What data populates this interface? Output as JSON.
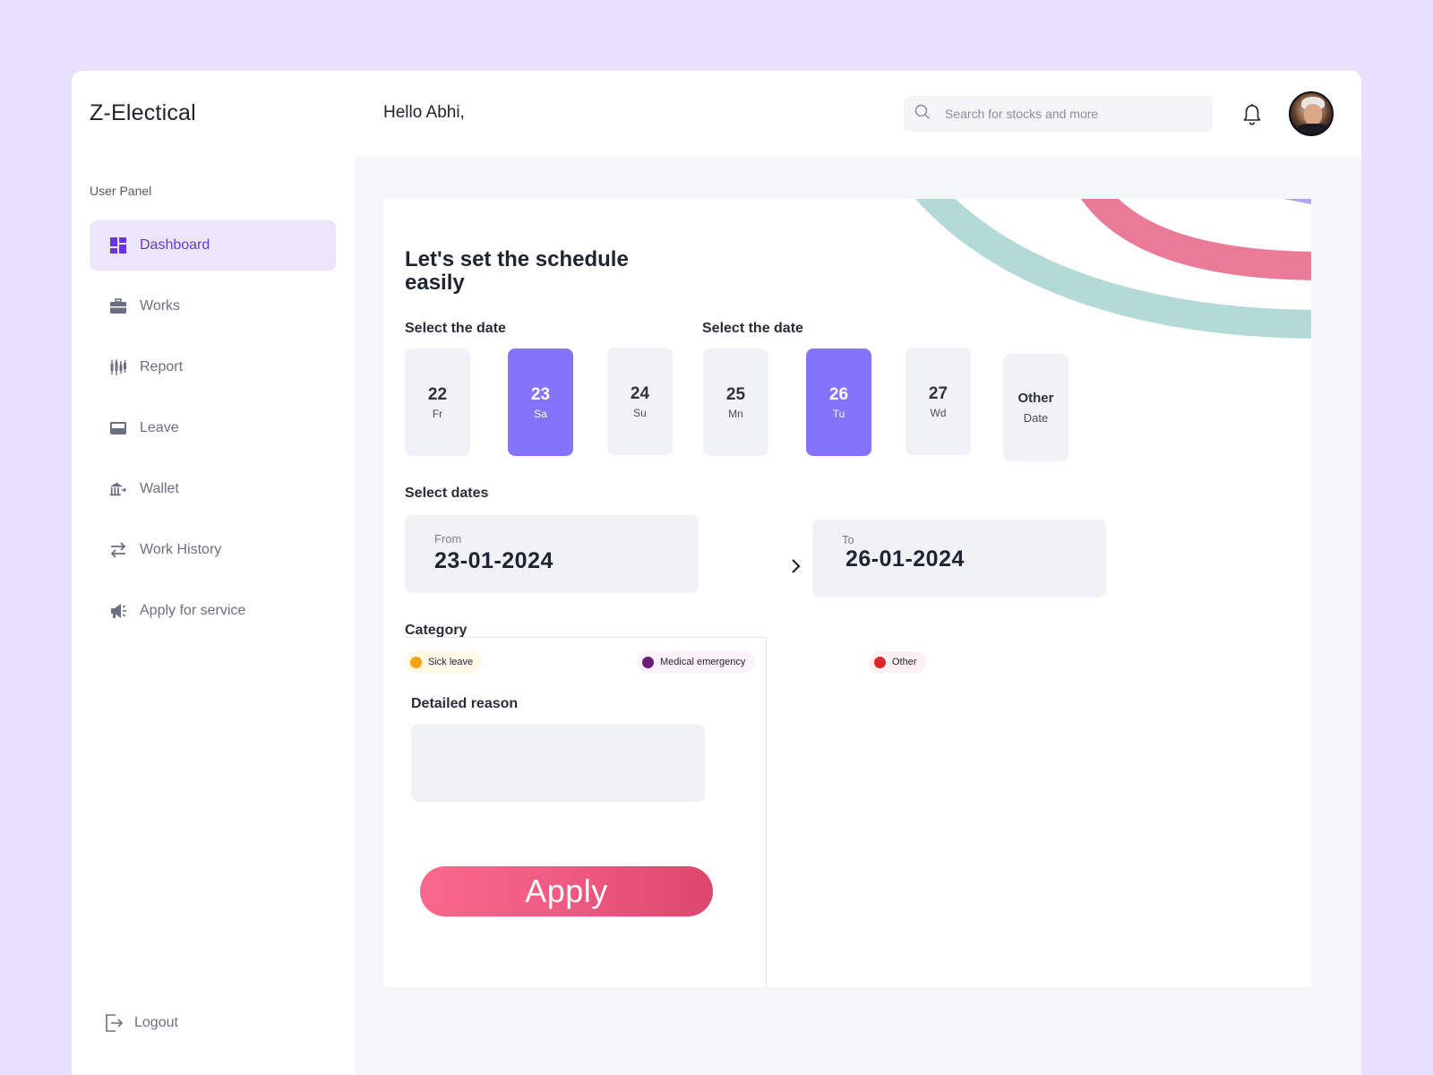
{
  "app": {
    "brand": "Z-Electical",
    "greeting": "Hello Abhi,"
  },
  "search": {
    "placeholder": "Search for stocks and more",
    "icon": "search-icon"
  },
  "header": {
    "notification_icon": "bell-icon",
    "avatar": "user-avatar"
  },
  "sidebar": {
    "panel_label": "User Panel",
    "items": [
      {
        "label": "Dashboard",
        "icon": "dashboard-icon",
        "active": true
      },
      {
        "label": "Works",
        "icon": "briefcase-icon",
        "active": false
      },
      {
        "label": "Report",
        "icon": "candlestick-chart-icon",
        "active": false
      },
      {
        "label": "Leave",
        "icon": "inbox-icon",
        "active": false
      },
      {
        "label": "Wallet",
        "icon": "bank-icon",
        "active": false
      },
      {
        "label": "Work History",
        "icon": "swap-arrows-icon",
        "active": false
      },
      {
        "label": "Apply for service",
        "icon": "megaphone-icon",
        "active": false
      }
    ],
    "logout_label": "Logout"
  },
  "schedule": {
    "title": "Let's set the schedule easily",
    "select_date_label_1": "Select the date",
    "select_date_label_2": "Select the date",
    "dates": [
      {
        "num": "22",
        "day": "Fr",
        "selected": false
      },
      {
        "num": "23",
        "day": "Sa",
        "selected": true
      },
      {
        "num": "24",
        "day": "Su",
        "selected": false
      },
      {
        "num": "25",
        "day": "Mn",
        "selected": false
      },
      {
        "num": "26",
        "day": "Tu",
        "selected": true
      },
      {
        "num": "27",
        "day": "Wd",
        "selected": false
      }
    ],
    "other_date": {
      "top": "Other",
      "bottom": "Date"
    },
    "select_dates_label": "Select dates",
    "from": {
      "label": "From",
      "value": "23-01-2024"
    },
    "to": {
      "label": "To",
      "value": "26-01-2024"
    },
    "category_label": "Category",
    "categories": [
      {
        "label": "Sick leave",
        "dot_color": "#f5a30b",
        "bg": "#fff8e6"
      },
      {
        "label": "Medical emergency",
        "dot_color": "#6b1a78",
        "bg": "#fbf1fb"
      },
      {
        "label": "Other",
        "dot_color": "#e0262d",
        "bg": "#fdf0f0"
      }
    ],
    "reason_label": "Detailed reason",
    "reason_value": "",
    "apply_label": "Apply"
  },
  "colors": {
    "accent": "#6a35e8",
    "tile_selected": "#8474fb",
    "apply_gradient_start": "#f9688c",
    "apply_gradient_end": "#de466c",
    "page_bg": "#e8e0fe"
  }
}
